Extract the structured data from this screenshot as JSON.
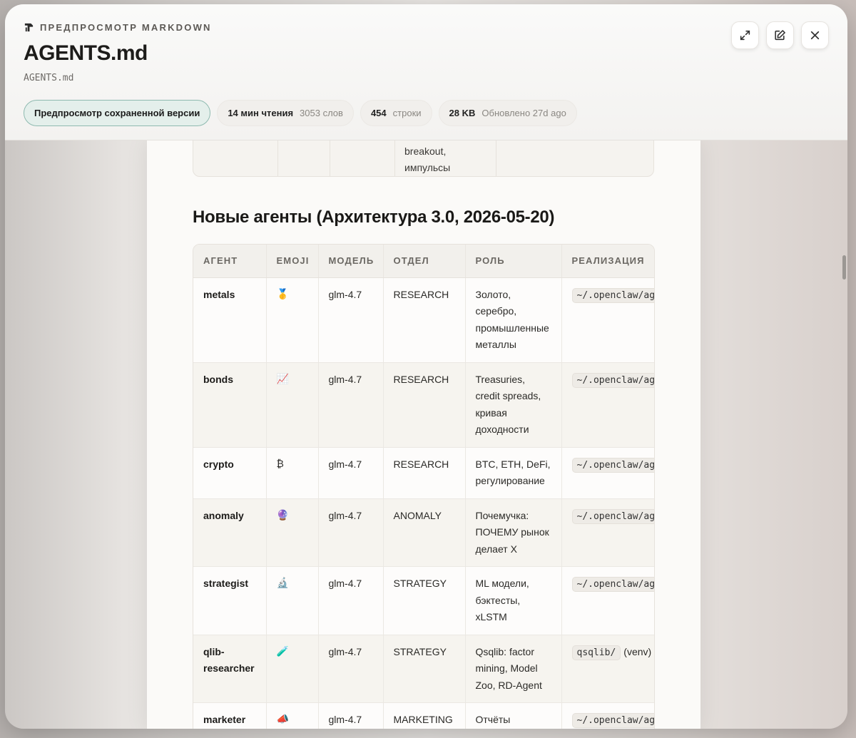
{
  "header": {
    "eyebrow": "ПРЕДПРОСМОТР MARKDOWN",
    "title": "AGENTS.md",
    "filename": "AGENTS.md",
    "buttons": [
      "expand-icon",
      "edit-icon",
      "close-icon"
    ]
  },
  "pills": {
    "preview_saved": "Предпросмотр сохраненной версии",
    "reading_time": "14 мин чтения",
    "words": "3053 слов",
    "lines_count": "454",
    "lines_label": "строки",
    "size": "28 KB",
    "updated": "Обновлено 27d ago"
  },
  "previous_table": {
    "cell_text_line1": "breakout,",
    "cell_text_line2": "импульсы"
  },
  "section": {
    "heading": "Новые агенты (Архитектура 3.0, 2026-05-20)"
  },
  "table": {
    "headers": [
      "АГЕНТ",
      "EMOJI",
      "МОДЕЛЬ",
      "ОТДЕЛ",
      "РОЛЬ",
      "РЕАЛИЗАЦИЯ"
    ],
    "rows": [
      {
        "agent": "metals",
        "emoji": "🥇",
        "model": "glm-4.7",
        "dept": "RESEARCH",
        "role": "Золото, серебро, промышленные металлы",
        "impl": "~/.openclaw/agents/metals",
        "impl_extra": ""
      },
      {
        "agent": "bonds",
        "emoji": "📈",
        "model": "glm-4.7",
        "dept": "RESEARCH",
        "role": "Treasuries, credit spreads, кривая доходности",
        "impl": "~/.openclaw/agents/bonds",
        "impl_extra": ""
      },
      {
        "agent": "crypto",
        "emoji": "₿",
        "model": "glm-4.7",
        "dept": "RESEARCH",
        "role": "BTC, ETH, DeFi, регулирование",
        "impl": "~/.openclaw/agents/crypto",
        "impl_extra": ""
      },
      {
        "agent": "anomaly",
        "emoji": "🔮",
        "model": "glm-4.7",
        "dept": "ANOMALY",
        "role": "Почемучка: ПОЧЕМУ рынок делает X",
        "impl": "~/.openclaw/agents/anomaly",
        "impl_extra": ""
      },
      {
        "agent": "strategist",
        "emoji": "🔬",
        "model": "glm-4.7",
        "dept": "STRATEGY",
        "role": "ML модели, бэктесты, xLSTM",
        "impl": "~/.openclaw/agents/strategist",
        "impl_extra": ""
      },
      {
        "agent": "qlib-researcher",
        "emoji": "🧪",
        "model": "glm-4.7",
        "dept": "STRATEGY",
        "role": "Qsqlib: factor mining, Model Zoo, RD-Agent",
        "impl": "qsqlib/",
        "impl_extra": "(venv)"
      },
      {
        "agent": "marketer",
        "emoji": "📣",
        "model": "glm-4.7",
        "dept": "MARKETING",
        "role": "Отчёты",
        "impl": "~/.openclaw/agents/marketer",
        "impl_extra": ""
      }
    ]
  }
}
